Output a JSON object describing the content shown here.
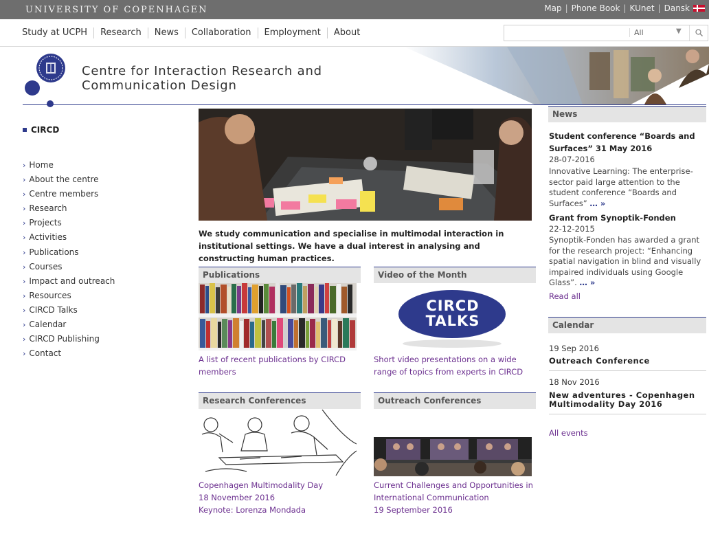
{
  "topbar": {
    "university": "UNIVERSITY OF COPENHAGEN",
    "links": [
      "Map",
      "Phone Book",
      "KUnet",
      "Dansk"
    ]
  },
  "mainnav": [
    "Study at UCPH",
    "Research",
    "News",
    "Collaboration",
    "Employment",
    "About"
  ],
  "search": {
    "value": "",
    "scope": "All"
  },
  "header": {
    "title_line1": "Centre for Interaction Research and",
    "title_line2": "Communication Design"
  },
  "leftnav": {
    "heading": "CIRCD",
    "items": [
      "Home",
      "About the centre",
      "Centre members",
      "Research",
      "Projects",
      "Activities",
      "Publications",
      "Courses",
      "Impact and outreach",
      "Resources",
      "CIRCD Talks",
      "Calendar",
      "CIRCD Publishing",
      "Contact"
    ]
  },
  "intro": "We study communication and specialise in multimodal interaction in institutional settings. We have a dual interest in analysing and constructing human practices.",
  "boxes": {
    "publications": {
      "title": "Publications",
      "link": "A list of recent publications by CIRCD members"
    },
    "video": {
      "title": "Video of the Month",
      "badge_line1": "CIRCD",
      "badge_line2": "TALKS",
      "link": "Short video presentations on a wide range of topics from experts in CIRCD"
    },
    "research": {
      "title": "Research Conferences",
      "link1": "Copenhagen Multimodality Day",
      "link2": "18 November 2016",
      "link3": "Keynote: Lorenza Mondada"
    },
    "outreach": {
      "title": "Outreach Conferences",
      "link1": "Current Challenges and Opportunities in",
      "link2": "International Communication",
      "link3": "19 September 2016"
    }
  },
  "news": {
    "heading": "News",
    "items": [
      {
        "title": "Student conference “Boards and Surfaces” 31 May 2016",
        "date": "28-07-2016",
        "text": "Innovative Learning: The enterprise-sector paid large attention to the student conference “Boards and Surfaces”",
        "more": "… »"
      },
      {
        "title": "Grant from Synoptik-Fonden",
        "date": "22-12-2015",
        "text": "Synoptik-Fonden has awarded a grant for the research project: “Enhancing spatial navigation in blind and visually impaired individuals using Google Glass”.",
        "more": "… »"
      }
    ],
    "read_all": "Read all"
  },
  "calendar": {
    "heading": "Calendar",
    "events": [
      {
        "date": "19 Sep 2016",
        "title": "Outreach Conference"
      },
      {
        "date": "18 Nov 2016",
        "title": "New adventures - Copenhagen Multimodality Day 2016"
      }
    ],
    "all_events": "All events"
  },
  "colors": {
    "brand_blue": "#2e3a8c",
    "link_purple": "#6b2f8f",
    "topbar_grey": "#6e6e6e"
  }
}
